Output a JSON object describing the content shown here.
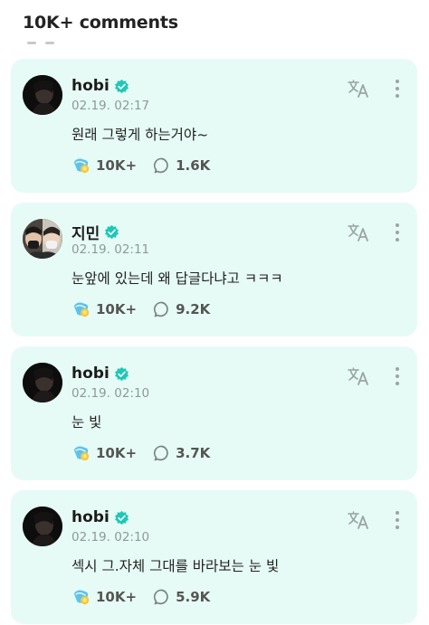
{
  "header": {
    "title": "10K+ comments"
  },
  "comments": [
    {
      "author": "hobi",
      "timestamp": "02.19. 02:17",
      "text": "원래 그렇게 하는거야~",
      "likes": "10K+",
      "replies": "1.6K",
      "avatar": "dark-portrait"
    },
    {
      "author": "지민",
      "timestamp": "02.19. 02:11",
      "text": "눈앞에 있는데 왜 답글다냐고 ㅋㅋㅋ",
      "likes": "10K+",
      "replies": "9.2K",
      "avatar": "two-people-selfie"
    },
    {
      "author": "hobi",
      "timestamp": "02.19. 02:10",
      "text": "눈 빛",
      "likes": "10K+",
      "replies": "3.7K",
      "avatar": "dark-portrait"
    },
    {
      "author": "hobi",
      "timestamp": "02.19. 02:10",
      "text": "섹시 그.자체 그대를 바라보는 눈 빛",
      "likes": "10K+",
      "replies": "5.9K",
      "avatar": "dark-portrait"
    }
  ],
  "colors": {
    "card_background": "#e6fbf5",
    "verified_badge": "#1fc7b6",
    "timestamp": "#8d9a98",
    "icon_gray": "#9aa5a3"
  },
  "icons": {
    "verified": "verified-badge-icon",
    "translate": "translate-icon",
    "more": "more-vertical-icon",
    "like": "cheer-hand-icon",
    "reply": "speech-bubble-icon"
  }
}
